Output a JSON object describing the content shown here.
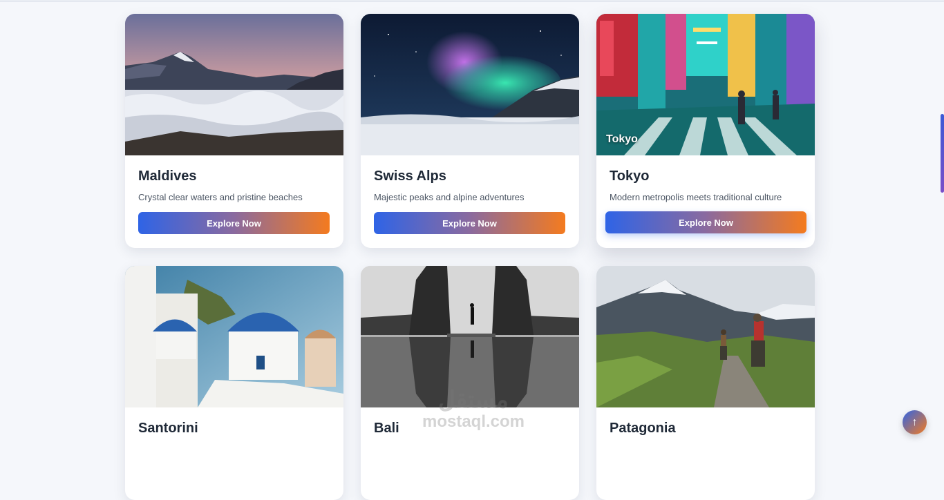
{
  "destinations": [
    {
      "name": "Maldives",
      "description": "Crystal clear waters and pristine beaches",
      "cta": "Explore Now",
      "overlay": ""
    },
    {
      "name": "Swiss Alps",
      "description": "Majestic peaks and alpine adventures",
      "cta": "Explore Now",
      "overlay": ""
    },
    {
      "name": "Tokyo",
      "description": "Modern metropolis meets traditional culture",
      "cta": "Explore Now",
      "overlay": "Tokyo"
    },
    {
      "name": "Santorini",
      "description": "",
      "cta": "",
      "overlay": ""
    },
    {
      "name": "Bali",
      "description": "",
      "cta": "",
      "overlay": ""
    },
    {
      "name": "Patagonia",
      "description": "",
      "cta": "",
      "overlay": ""
    }
  ],
  "back_to_top": {
    "icon": "arrow-up-icon",
    "glyph": "↑"
  },
  "watermark": {
    "arabic": "مستقل",
    "latin": "mostaql.com"
  },
  "colors": {
    "accent_start": "#2f64e6",
    "accent_end": "#f47b1f",
    "title": "#1f2937",
    "text": "#4b5563",
    "background": "#f5f7fb"
  }
}
